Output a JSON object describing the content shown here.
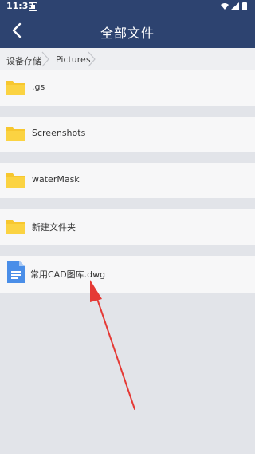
{
  "status_bar": {
    "time": "11:33"
  },
  "header": {
    "title": "全部文件",
    "back_icon": "chevron-left-icon"
  },
  "breadcrumb": {
    "items": [
      "设备存储",
      "Pictures"
    ]
  },
  "files": [
    {
      "name": ".gs",
      "type": "folder"
    },
    {
      "name": "Screenshots",
      "type": "folder"
    },
    {
      "name": "waterMask",
      "type": "folder"
    },
    {
      "name": "新建文件夹",
      "type": "folder"
    },
    {
      "name": "常用CAD图库.dwg",
      "type": "file"
    }
  ],
  "colors": {
    "header": "#2d4370",
    "folder": "#f7c72f",
    "file": "#4a8ee8",
    "annotation_arrow": "#e53935"
  }
}
